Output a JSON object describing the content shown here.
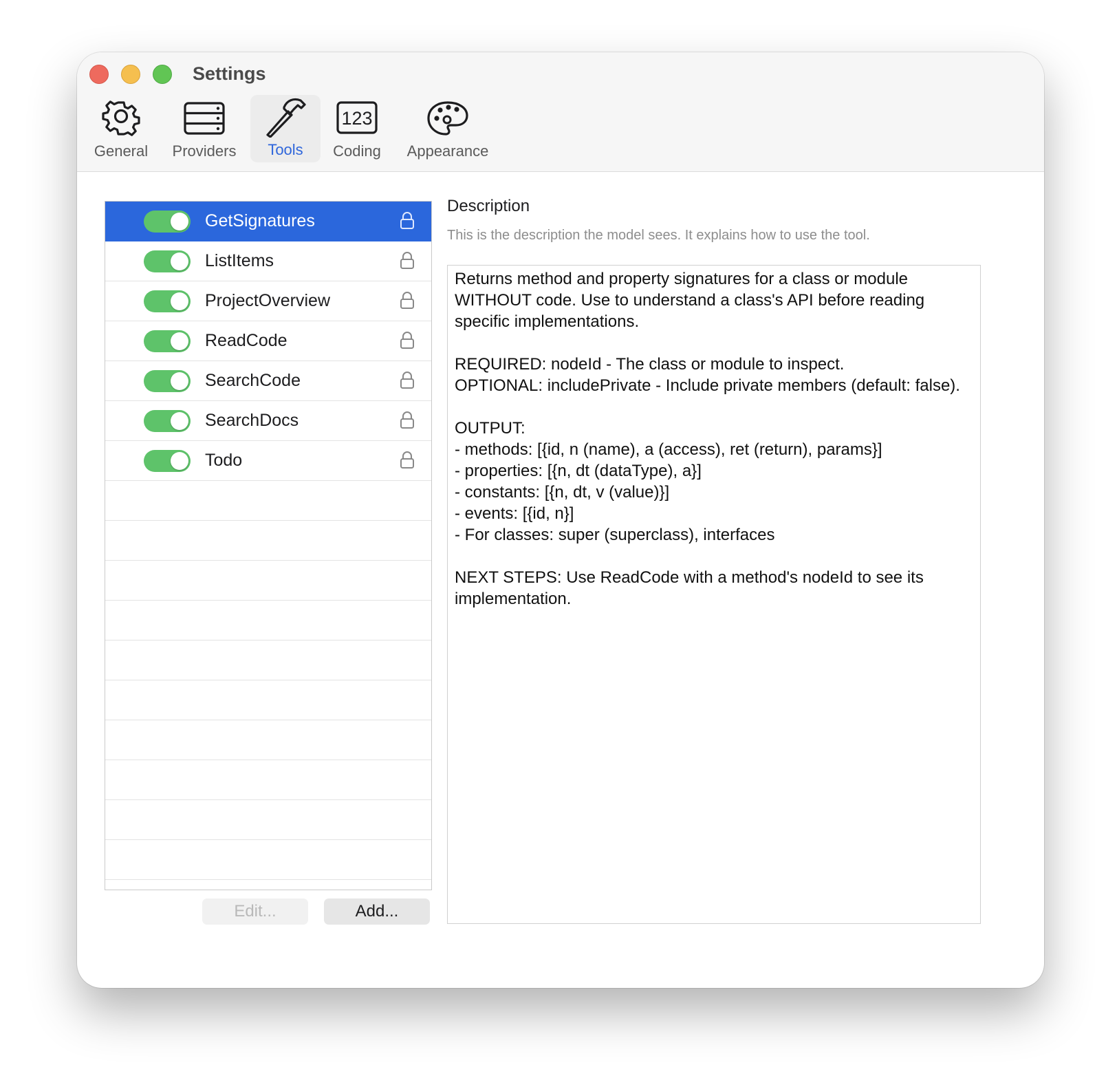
{
  "window": {
    "title": "Settings"
  },
  "toolbar": {
    "tabs": [
      {
        "label": "General",
        "icon": "gear-icon"
      },
      {
        "label": "Providers",
        "icon": "server-icon"
      },
      {
        "label": "Tools",
        "icon": "hammer-icon",
        "active": true
      },
      {
        "label": "Coding",
        "icon": "numbers-123-icon"
      },
      {
        "label": "Appearance",
        "icon": "palette-icon"
      }
    ]
  },
  "tools": {
    "items": [
      {
        "label": "GetSignatures",
        "enabled": true,
        "locked": true,
        "selected": true
      },
      {
        "label": "ListItems",
        "enabled": true,
        "locked": true
      },
      {
        "label": "ProjectOverview",
        "enabled": true,
        "locked": true
      },
      {
        "label": "ReadCode",
        "enabled": true,
        "locked": true
      },
      {
        "label": "SearchCode",
        "enabled": true,
        "locked": true
      },
      {
        "label": "SearchDocs",
        "enabled": true,
        "locked": true
      },
      {
        "label": "Todo",
        "enabled": true,
        "locked": true
      }
    ],
    "edit_label": "Edit...",
    "add_label": "Add..."
  },
  "description": {
    "title": "Description",
    "hint": "This is the description the model sees. It explains how to use the tool.",
    "text": "Returns method and property signatures for a class or module WITHOUT code. Use to understand a class's API before reading specific implementations.\n\nREQUIRED: nodeId - The class or module to inspect.\nOPTIONAL: includePrivate - Include private members (default: false).\n\nOUTPUT:\n- methods: [{id, n (name), a (access), ret (return), params}]\n- properties: [{n, dt (dataType), a}]\n- constants: [{n, dt, v (value)}]\n- events: [{id, n}]\n- For classes: super (superclass), interfaces\n\nNEXT STEPS: Use ReadCode with a method's nodeId to see its implementation."
  },
  "colors": {
    "accent": "#2b67dc",
    "toggle_on": "#5ec36a",
    "close": "#ee6a5e",
    "minimize": "#f5bf4f",
    "zoom": "#61c554"
  }
}
